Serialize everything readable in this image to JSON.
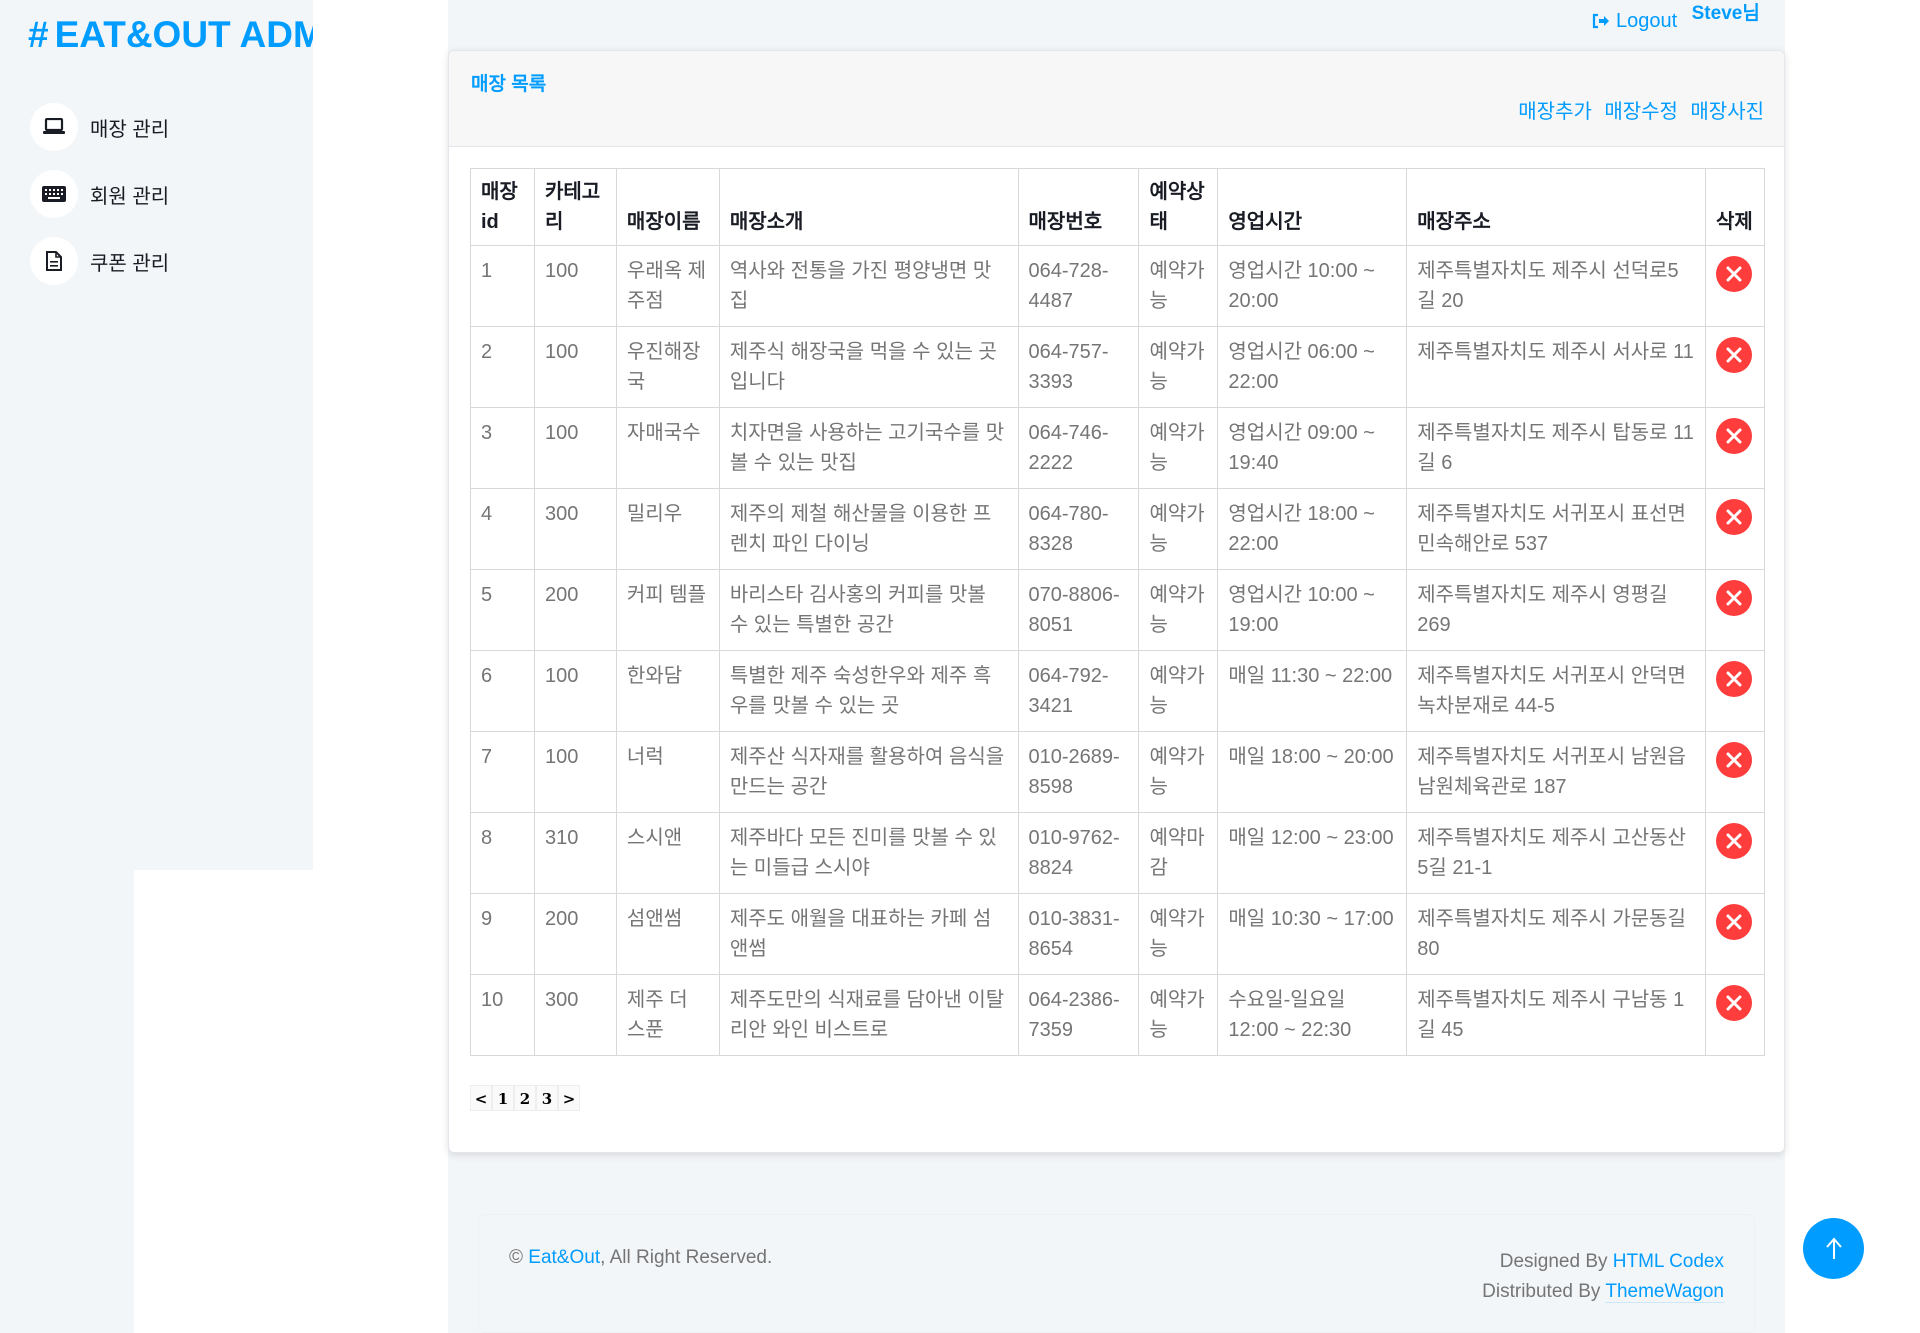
{
  "brand": {
    "hash": "#",
    "title": "EAT&OUT ADM"
  },
  "sidebar": {
    "items": [
      {
        "label": "매장 관리",
        "icon": "laptop-icon"
      },
      {
        "label": "회원 관리",
        "icon": "keyboard-icon"
      },
      {
        "label": "쿠폰 관리",
        "icon": "file-icon"
      }
    ]
  },
  "topbar": {
    "logout_label": "Logout",
    "user_name": "Steve님"
  },
  "card": {
    "title": "매장 목록",
    "actions": [
      "매장추가",
      "매장수정",
      "매장사진"
    ]
  },
  "table": {
    "headers": [
      "매장id",
      "카테고리",
      "매장이름",
      "매장소개",
      "매장번호",
      "예약상태",
      "영업시간",
      "매장주소",
      "삭제"
    ],
    "rows": [
      [
        "1",
        "100",
        "우래옥 제주점",
        "역사와 전통을 가진 평양냉면 맛집",
        "064-728-4487",
        "예약가능",
        "영업시간 10:00 ~ 20:00",
        "제주특별자치도 제주시 선덕로5길 20"
      ],
      [
        "2",
        "100",
        "우진해장국",
        "제주식 해장국을 먹을 수 있는 곳입니다",
        "064-757-3393",
        "예약가능",
        "영업시간 06:00 ~ 22:00",
        "제주특별자치도 제주시 서사로 11"
      ],
      [
        "3",
        "100",
        "자매국수",
        "치자면을 사용하는 고기국수를 맛볼 수 있는 맛집",
        "064-746-2222",
        "예약가능",
        "영업시간 09:00 ~ 19:40",
        "제주특별자치도 제주시 탑동로 11길 6"
      ],
      [
        "4",
        "300",
        "밀리우",
        "제주의 제철 해산물을 이용한 프렌치 파인 다이닝",
        "064-780-8328",
        "예약가능",
        "영업시간 18:00 ~ 22:00",
        "제주특별자치도 서귀포시 표선면 민속해안로 537"
      ],
      [
        "5",
        "200",
        "커피 템플",
        "바리스타 김사홍의 커피를 맛볼 수 있는 특별한 공간",
        "070-8806-8051",
        "예약가능",
        "영업시간 10:00 ~ 19:00",
        "제주특별자치도 제주시 영평길 269"
      ],
      [
        "6",
        "100",
        "한와담",
        "특별한 제주 숙성한우와 제주 흑우를 맛볼 수 있는 곳",
        "064-792-3421",
        "예약가능",
        "매일 11:30 ~ 22:00",
        "제주특별자치도 서귀포시 안덕면 녹차분재로 44-5"
      ],
      [
        "7",
        "100",
        "너럭",
        "제주산 식자재를 활용하여 음식을 만드는 공간",
        "010-2689-8598",
        "예약가능",
        "매일 18:00 ~ 20:00",
        "제주특별자치도 서귀포시 남원읍 남원체육관로 187"
      ],
      [
        "8",
        "310",
        "스시앤",
        "제주바다 모든 진미를 맛볼 수 있는 미들급 스시야",
        "010-9762-8824",
        "예약마감",
        "매일 12:00 ~ 23:00",
        "제주특별자치도 제주시 고산동산 5길 21-1"
      ],
      [
        "9",
        "200",
        "섬앤썸",
        "제주도 애월을 대표하는 카페 섬앤썸",
        "010-3831-8654",
        "예약가능",
        "매일 10:30 ~ 17:00",
        "제주특별자치도 제주시 가문동길 80"
      ],
      [
        "10",
        "300",
        "제주 더 스푼",
        "제주도만의 식재료를 담아낸 이탈리안 와인 비스트로",
        "064-2386-7359",
        "예약가능",
        "수요일-일요일 12:00 ~ 22:30",
        "제주특별자치도 제주시 구남동 1길 45"
      ]
    ]
  },
  "pager": [
    "<",
    "1",
    "2",
    "3",
    ">"
  ],
  "footer": {
    "copyright_symbol": "©",
    "site_link": "Eat&Out",
    "rights": ", All Right Reserved.",
    "designed_by": "Designed By",
    "designer_link": "HTML Codex",
    "distributed_by": "Distributed By",
    "distributor_link": "ThemeWagon"
  },
  "colors": {
    "accent": "#009cff",
    "danger": "#ff3d3d",
    "background": "#f3f6f9"
  }
}
